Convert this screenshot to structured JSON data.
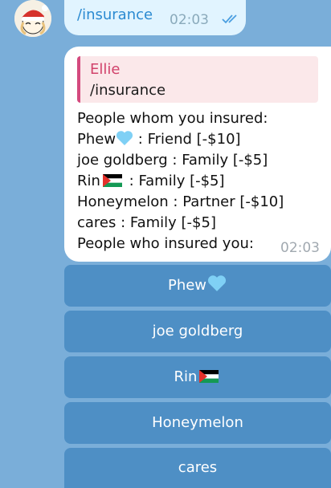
{
  "outgoing": {
    "text": "/insurance",
    "time": "02:03"
  },
  "incoming": {
    "reply": {
      "name": "Ellie",
      "text": "/insurance"
    },
    "lines": [
      "People whom you insured:",
      "Phew",
      ": Friend [-$10]",
      "joe goldberg : Family [-$5]",
      "Rin",
      ": Family [-$5]",
      "Honeymelon : Partner [-$10]",
      "cares : Family [-$5]",
      "People who insured you:"
    ],
    "time": "02:03"
  },
  "keyboard": {
    "buttons": [
      {
        "label": "Phew",
        "emoji": "light-blue-heart-icon"
      },
      {
        "label": "joe goldberg"
      },
      {
        "label": "Rin",
        "emoji": "palestine-flag-icon"
      },
      {
        "label": "Honeymelon"
      },
      {
        "label": "cares"
      }
    ]
  },
  "colors": {
    "background": "#7aaed9",
    "outgoing_bubble": "#e1f4ff",
    "keyboard_button": "#4e8fc5",
    "reply_accent": "#d44a7e"
  }
}
